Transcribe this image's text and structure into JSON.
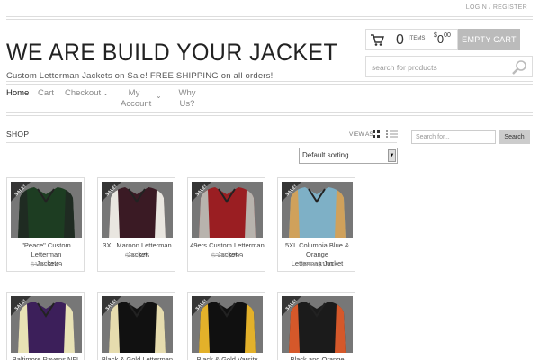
{
  "header": {
    "login": "LOGIN / REGISTER",
    "site_title": "WE ARE BUILD YOUR JACKET",
    "tagline": "Custom Letterman Jackets on Sale! FREE SHIPPING on all orders!"
  },
  "cart": {
    "count": "0",
    "items_label": "ITEMS",
    "currency": "$",
    "amount": "0",
    "cents": "00",
    "empty_label": "EMPTY CART"
  },
  "search": {
    "placeholder": "search for products"
  },
  "nav": {
    "home": "Home",
    "cart": "Cart",
    "checkout": "Checkout",
    "my": "My",
    "account": "Account",
    "why": "Why",
    "us": "Us?"
  },
  "shop": {
    "title": "SHOP",
    "view_as": "VIEW AS",
    "sort_selected": "Default sorting"
  },
  "sidebar": {
    "search_placeholder": "Search for...",
    "search_button": "Search"
  },
  "sale_badge": "SALE!",
  "products": [
    {
      "name_line1": "\"Peace\" Custom Letterman",
      "name_line2": "Jacket",
      "old_price": "$189",
      "price": "$149",
      "colors": [
        "#1d3d22",
        "#1f2b22"
      ]
    },
    {
      "name_line1": "3XL Maroon Letterman Jacket",
      "name_line2": "",
      "old_price": "$89",
      "price": "$75",
      "colors": [
        "#3a1a24",
        "#e9e6e0"
      ]
    },
    {
      "name_line1": "49ers Custom Letterman Jacket",
      "name_line2": "",
      "old_price": "$395",
      "price": "$299",
      "colors": [
        "#9a1e22",
        "#b8b3ad"
      ]
    },
    {
      "name_line1": "5XL Columbia Blue & Orange",
      "name_line2": "Letterman Jacket",
      "old_price": "$284",
      "price": "$150",
      "colors": [
        "#7eb0c6",
        "#d0a15b"
      ]
    },
    {
      "name_line1": "Baltimore Ravens NFL Varsity",
      "name_line2": "",
      "old_price": "",
      "price": "",
      "colors": [
        "#3c1f5a",
        "#e8e2b5"
      ]
    },
    {
      "name_line1": "Black & Gold Letterman Jacket",
      "name_line2": "",
      "old_price": "",
      "price": "",
      "colors": [
        "#111111",
        "#e6dcae"
      ]
    },
    {
      "name_line1": "Black & Gold Varsity Sweater",
      "name_line2": "",
      "old_price": "",
      "price": "",
      "colors": [
        "#101010",
        "#e3b12a"
      ]
    },
    {
      "name_line1": "Black and Orange Custom",
      "name_line2": "",
      "old_price": "",
      "price": "",
      "colors": [
        "#1b1b1b",
        "#d5582a"
      ]
    }
  ]
}
